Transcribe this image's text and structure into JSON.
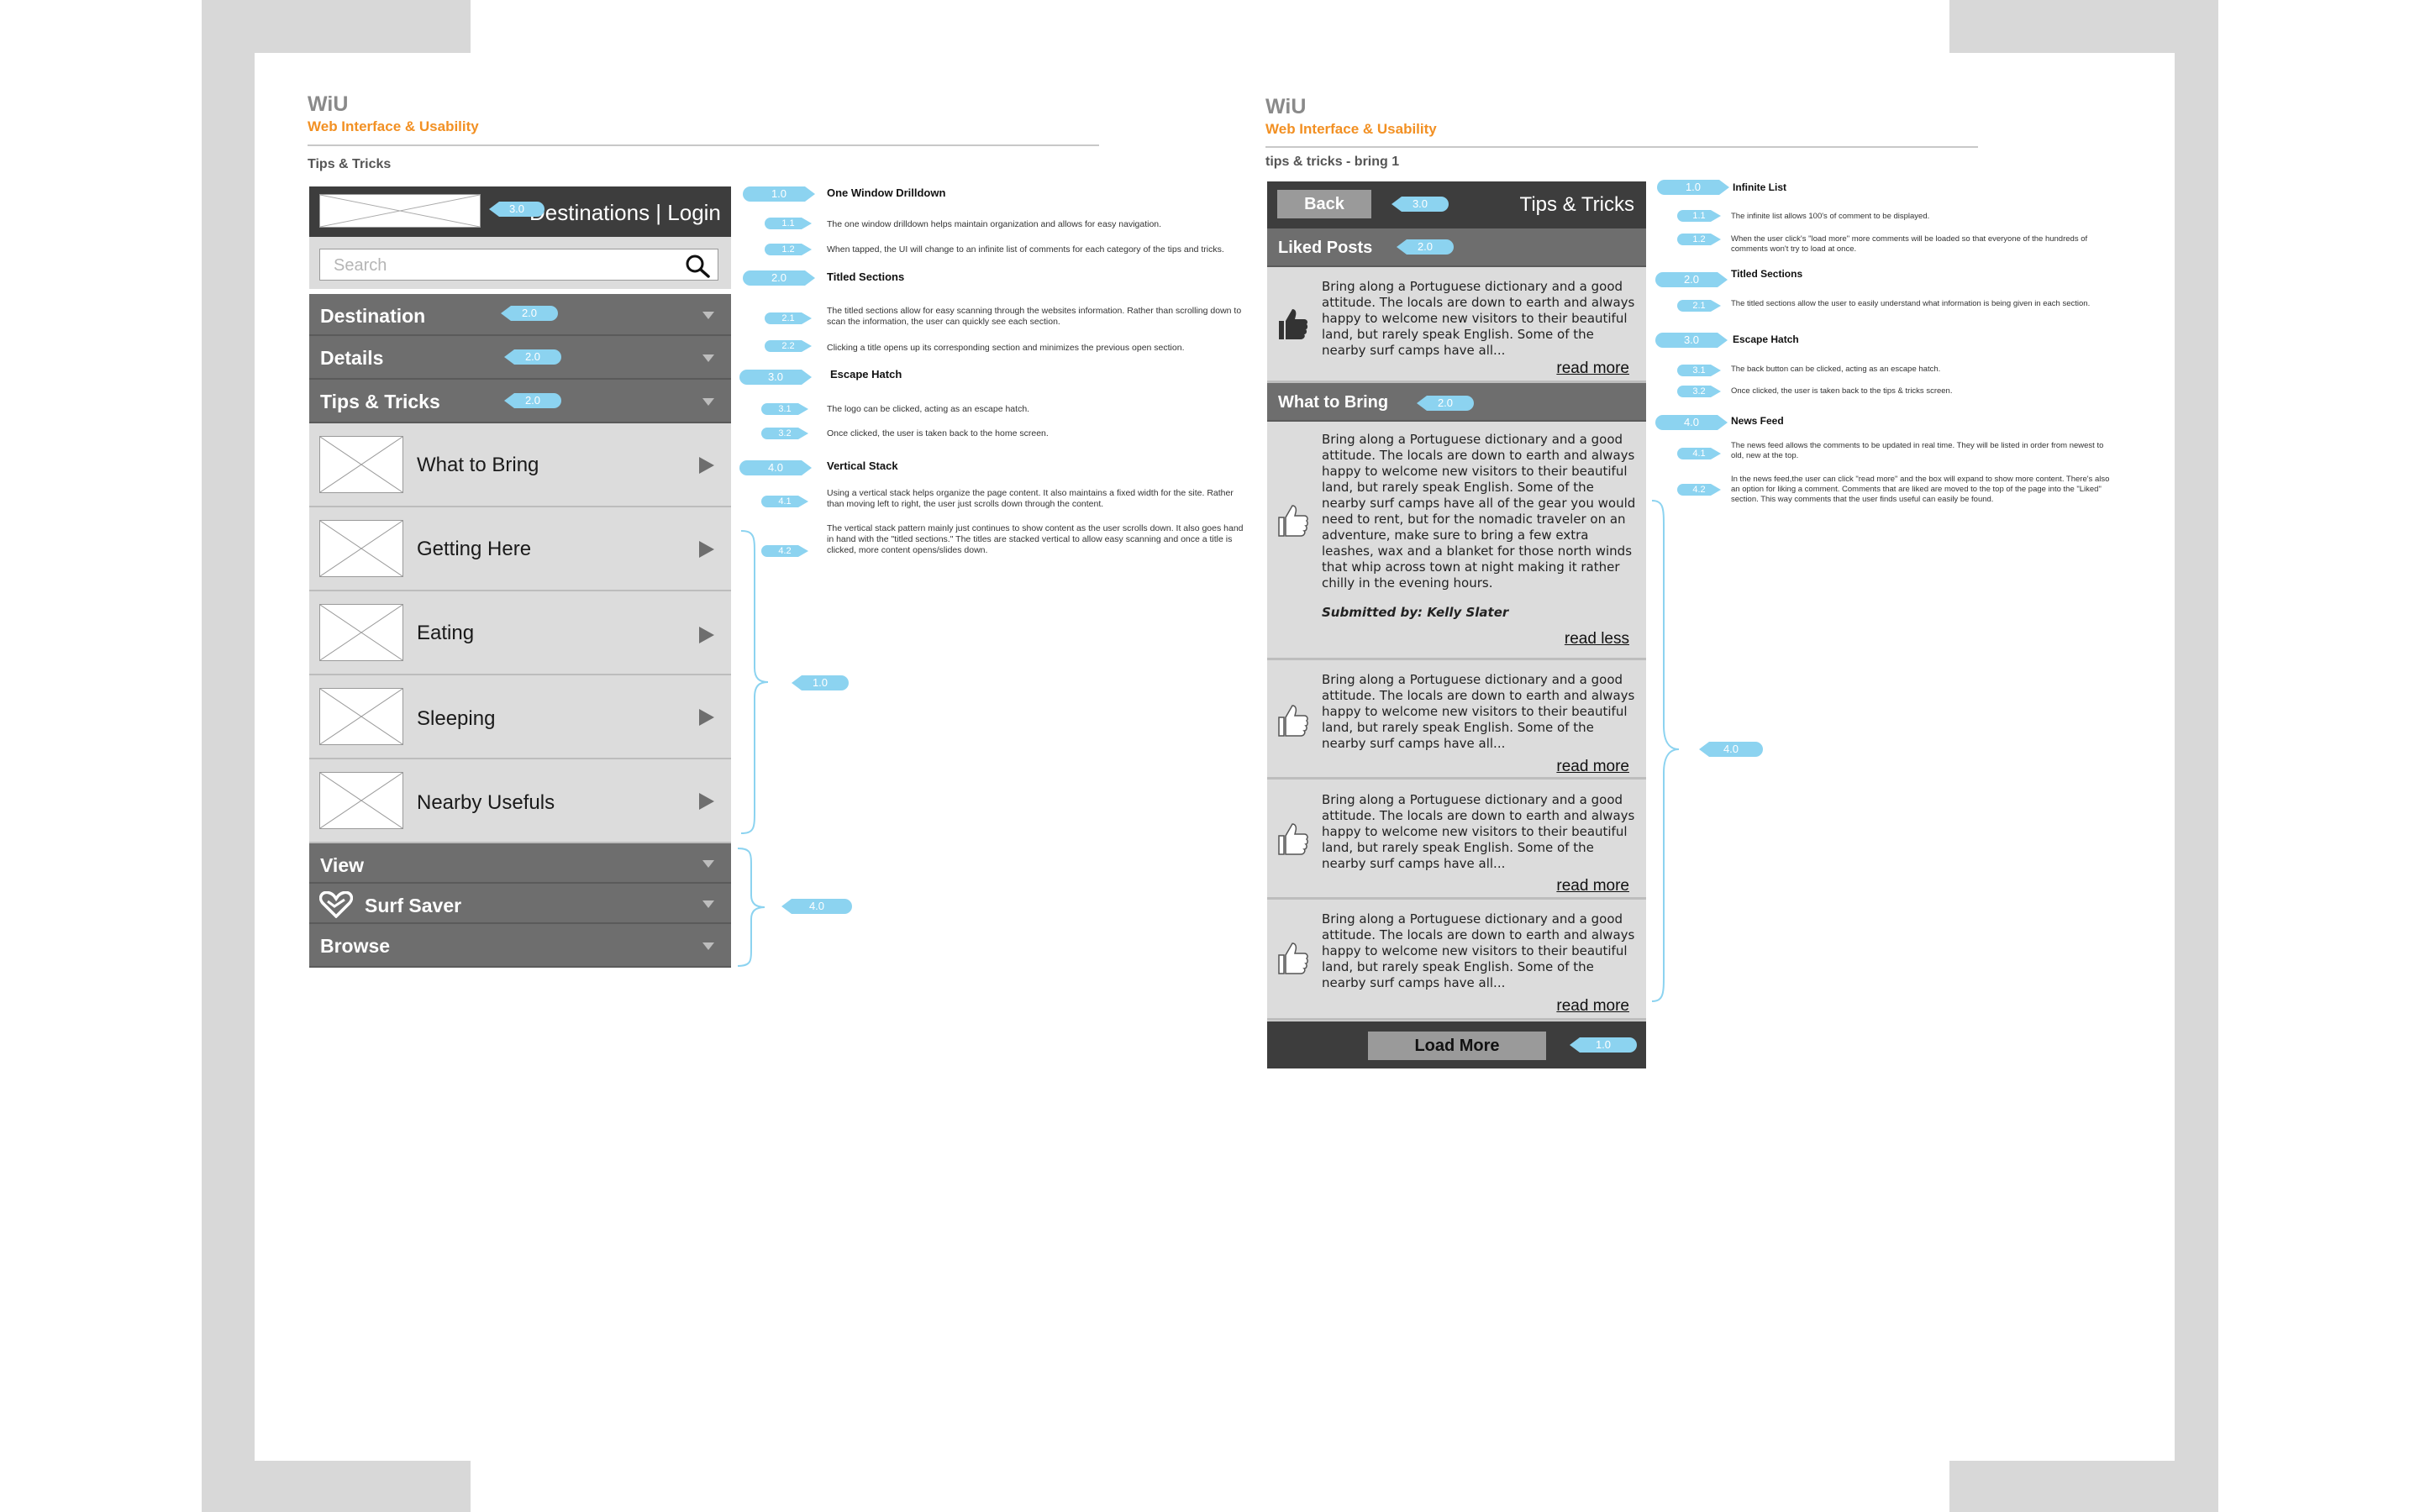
{
  "left_page": {
    "title": "WiU",
    "subtitle": "Web Interface & Usability",
    "page_label": "Tips & Tricks",
    "phone": {
      "header_text": "Destinations | Login",
      "search_placeholder": "Search",
      "sections_top": [
        {
          "label": "Destination",
          "marker": "2.0"
        },
        {
          "label": "Details",
          "marker": "2.0"
        },
        {
          "label": "Tips & Tricks",
          "marker": "2.0"
        }
      ],
      "items": [
        "What to Bring",
        "Getting Here",
        "Eating",
        "Sleeping",
        "Nearby Usefuls"
      ],
      "sections_bottom": [
        "View",
        "Surf Saver",
        "Browse"
      ],
      "header_marker": "3.0"
    },
    "bracket_markers": {
      "items": "1.0",
      "bottom": "4.0"
    },
    "notes": [
      {
        "num": "1.0",
        "head": "One Window Drilldown"
      },
      {
        "num": "1.1",
        "text": "The one window drilldown helps maintain organization and allows for easy navigation."
      },
      {
        "num": "1.2",
        "text": "When tapped, the UI will change to an infinite list of comments for each category of the tips and tricks."
      },
      {
        "num": "2.0",
        "head": "Titled Sections"
      },
      {
        "num": "2.1",
        "text": "The titled sections allow for easy scanning through the websites information. Rather than scrolling down to scan the information, the user can quickly see each section."
      },
      {
        "num": "2.2",
        "text": "Clicking a title opens up its corresponding section and minimizes the previous open section."
      },
      {
        "num": "3.0",
        "head": "Escape Hatch"
      },
      {
        "num": "3.1",
        "text": "The logo can be clicked, acting as an escape hatch."
      },
      {
        "num": "3.2",
        "text": "Once clicked, the user is taken back to the home screen."
      },
      {
        "num": "4.0",
        "head": "Vertical Stack"
      },
      {
        "num": "4.1",
        "text": "Using a vertical stack helps organize the page content. It also maintains a fixed width for the site. Rather than moving left to right, the user just scrolls down through the content."
      },
      {
        "num": "4.2",
        "text": "The vertical stack pattern mainly just continues to show content as the user scrolls down. It also goes hand in hand with the \"titled sections.\" The titles are stacked vertical to allow easy scanning and once a title is clicked, more content opens/slides down."
      }
    ]
  },
  "right_page": {
    "title": "WiU",
    "subtitle": "Web Interface & Usability",
    "page_label": "tips & tricks - bring  1",
    "phone": {
      "back_label": "Back",
      "back_marker": "3.0",
      "header_title": "Tips & Tricks",
      "liked_label": "Liked Posts",
      "liked_marker": "2.0",
      "liked_post": {
        "text": "Bring along a Portuguese dictionary and a good attitude. The locals are down to earth and always happy to welcome new visitors to their beautiful land, but rarely speak English. Some of the nearby surf camps have all...",
        "link": "read more"
      },
      "section_label": "What to Bring",
      "section_marker": "2.0",
      "expanded_post": {
        "text": "Bring along a Portuguese dictionary and a good attitude. The locals are down to earth and always happy to welcome new visitors to their beautiful land, but rarely speak English. Some of the nearby surf camps have all of the gear you would need to rent, but for the nomadic traveler on an adventure, make sure to bring a few extra leashes, wax and a blanket for those north winds that whip across town at night making it rather chilly in the evening hours.",
        "author": "Submitted by: Kelly Slater",
        "link": "read less"
      },
      "posts": [
        {
          "text": "Bring along a Portuguese dictionary and a good attitude. The locals are down to earth and always happy to welcome new visitors to their beautiful land, but rarely speak English. Some of the nearby surf camps have all...",
          "link": "read more"
        },
        {
          "text": "Bring along a Portuguese dictionary and a good attitude. The locals are down to earth and always happy to welcome new visitors to their beautiful land, but rarely speak English. Some of the nearby surf camps have all...",
          "link": "read more"
        },
        {
          "text": "Bring along a Portuguese dictionary and a good attitude. The locals are down to earth and always happy to welcome new visitors to their beautiful land, but rarely speak English. Some of the nearby surf camps have all...",
          "link": "read more"
        }
      ],
      "load_more_label": "Load More",
      "load_more_marker": "1.0"
    },
    "bracket_marker": "4.0",
    "notes": [
      {
        "num": "1.0",
        "head": "Infinite List"
      },
      {
        "num": "1.1",
        "text": "The infinite list allows 100's of comment to be displayed."
      },
      {
        "num": "1.2",
        "text": "When the user click's \"load more\" more comments will be loaded so that everyone of the hundreds of comments won't try to load at once."
      },
      {
        "num": "2.0",
        "head": "Titled Sections"
      },
      {
        "num": "2.1",
        "text": "The titled sections allow the user to easily understand what information is being given in each section."
      },
      {
        "num": "3.0",
        "head": "Escape Hatch"
      },
      {
        "num": "3.1",
        "text": "The back button can be clicked, acting as an escape hatch."
      },
      {
        "num": "3.2",
        "text": "Once clicked, the user is taken back to the tips & tricks screen."
      },
      {
        "num": "4.0",
        "head": "News Feed"
      },
      {
        "num": "4.1",
        "text": "The news feed allows the comments to be updated in real time. They will be listed in order from newest to old, new at the top."
      },
      {
        "num": "4.2",
        "text": "In the news feed,the user can click \"read more\" and the box will expand to show more content. There's also an option for liking a comment. Comments that are liked are moved to the top of the page into the \"Liked\" section. This way comments that the user finds useful can easily be found."
      }
    ]
  },
  "colors": {
    "accent_orange": "#f29023",
    "marker_blue": "#8cd3f0",
    "bar_dark": "#3d3d3d",
    "bar_mid": "#6e6e6e",
    "row_light": "#dcdcdc"
  }
}
